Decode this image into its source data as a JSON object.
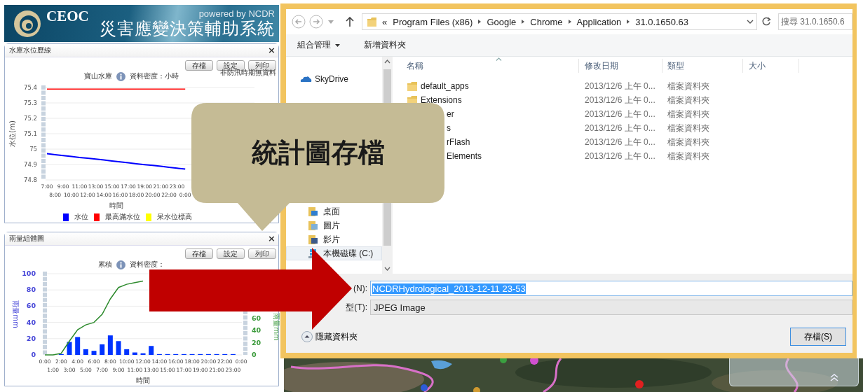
{
  "header": {
    "logo": "CEOC",
    "powered_by": "powered by NCDR",
    "title": "災害應變決策輔助系統"
  },
  "panels": [
    {
      "title": "水庫水位歷線",
      "close": "×",
      "buttons": [
        "存檔",
        "設定",
        "列印"
      ],
      "note": "非防汛時期無資料",
      "chart_title": "寶山水庫",
      "density": "資料密度：小時",
      "chart_data": {
        "type": "line",
        "grid": true,
        "xlabel": "時間",
        "ylabel": "水位(m)",
        "categories": [
          "7:00",
          "8:00",
          "9:00",
          "10:00",
          "11:00",
          "12:00",
          "13:00",
          "14:00",
          "15:00",
          "16:00",
          "17:00",
          "18:00",
          "19:00",
          "20:00",
          "21:00",
          "22:00",
          "23:00",
          "0:00"
        ],
        "ylim": [
          74.8,
          75.4
        ],
        "yticks": [
          74.8,
          74.9,
          75,
          75.1,
          75.2,
          75.3,
          75.4
        ],
        "series": [
          {
            "name": "水位",
            "color": "#0000ff",
            "values": [
              74.97,
              74.964,
              74.958,
              74.952,
              74.946,
              74.941,
              74.935,
              74.929,
              74.923,
              74.917,
              74.911,
              74.905,
              74.899,
              74.894,
              74.888,
              74.882,
              74.876,
              74.87
            ]
          },
          {
            "name": "最高滿水位",
            "color": "#ff0000",
            "values": [
              75.39,
              75.39,
              75.39,
              75.39,
              75.39,
              75.39,
              75.39,
              75.39,
              75.39,
              75.39,
              75.39,
              75.39,
              75.39,
              75.39,
              75.39,
              75.39,
              75.39,
              75.39
            ]
          },
          {
            "name": "呆水位標高",
            "color": "#ffff00",
            "values": [
              null,
              null,
              null,
              null,
              null,
              null,
              null,
              null,
              null,
              null,
              null,
              null,
              null,
              null,
              null,
              null,
              null,
              null
            ]
          }
        ]
      }
    },
    {
      "title": "雨量組體圖",
      "close": "×",
      "buttons": [
        "存檔",
        "設定",
        "列印"
      ],
      "chart_title": "累積",
      "density": "資料密度：",
      "right_axis": {
        "label": "雨量mm",
        "ticks": [
          "60",
          "40",
          "20",
          "0"
        ]
      },
      "chart_data": {
        "type": "bar",
        "grid": true,
        "xlabel": "時間",
        "ylabel": "雨量mm",
        "categories": [
          "0:00",
          "1:00",
          "2:00",
          "3:00",
          "4:00",
          "5:00",
          "6:00",
          "7:00",
          "8:00",
          "9:00",
          "10:00",
          "11:00",
          "12:00",
          "13:00",
          "14:00",
          "15:00",
          "16:00",
          "17:00",
          "18:00",
          "19:00",
          "20:00",
          "21:00",
          "22:00",
          "23:00",
          "0:00"
        ],
        "ylim": [
          0,
          100
        ],
        "yticks": [
          0,
          20,
          40,
          60,
          80,
          100
        ],
        "series": [
          {
            "color": "#0033ff",
            "values": [
              0,
              0,
              1,
              16,
              22,
              7,
              5,
              13,
              24,
              17,
              7,
              3,
              2,
              11,
              1,
              1,
              1,
              1,
              1,
              1,
              1,
              1,
              1,
              1,
              null
            ]
          },
          {
            "type": "line",
            "color": "#2e8b2e",
            "values": [
              0,
              0,
              2,
              17,
              31,
              37,
              40,
              50,
              69,
              83,
              87,
              89,
              91,
              null,
              null,
              null,
              null,
              null,
              null,
              null,
              null,
              null,
              null,
              null,
              null
            ]
          }
        ]
      }
    }
  ],
  "dialog": {
    "breadcrumb": [
      "«",
      "Program Files (x86)",
      "Google",
      "Chrome",
      "Application",
      "31.0.1650.63"
    ],
    "search": {
      "placeholder": "搜尋 31.0.1650.6"
    },
    "toolbar": [
      {
        "label": "組合管理",
        "menu": true
      },
      {
        "label": "新增資料夾",
        "menu": false
      }
    ],
    "nav": [
      {
        "label": "SkyDrive",
        "kind": "cloud",
        "selected": false
      },
      {
        "label": "桌面",
        "kind": "desktop",
        "selected": false
      },
      {
        "label": "圖片",
        "kind": "pictures",
        "selected": false
      },
      {
        "label": "影片",
        "kind": "videos",
        "selected": false
      },
      {
        "label": "本機磁碟 (C:)",
        "kind": "drive",
        "selected": true
      }
    ],
    "columns": [
      "名稱",
      "修改日期",
      "類型",
      "大小"
    ],
    "rows": [
      {
        "name": "default_apps",
        "kind": "folder",
        "modified": "2013/12/6 上午 0...",
        "type": "檔案資料夾"
      },
      {
        "name": "Extensions",
        "kind": "folder",
        "modified": "2013/12/6 上午 0...",
        "type": "檔案資料夾"
      },
      {
        "name": "er",
        "kind": "partial",
        "modified": "2013/12/6 上午 0...",
        "type": "檔案資料夾"
      },
      {
        "name": "s",
        "kind": "partial",
        "modified": "2013/12/6 上午 0...",
        "type": "檔案資料夾"
      },
      {
        "name": "rFlash",
        "kind": "partial",
        "modified": "2013/12/6 上午 0...",
        "type": "檔案資料夾"
      },
      {
        "name": "Elements",
        "kind": "partial",
        "modified": "2013/12/6 上午 0...",
        "type": "檔案資料夾"
      }
    ],
    "filename": {
      "label": "(N):",
      "value": "NCDRHydrological_2013-12-11 23-53"
    },
    "filetype": {
      "label": "型(T):",
      "value": "JPEG Image"
    },
    "hide_folders": "隱藏資料夾",
    "save": "存檔(S)"
  },
  "callout": {
    "text": "統計圖存檔"
  }
}
